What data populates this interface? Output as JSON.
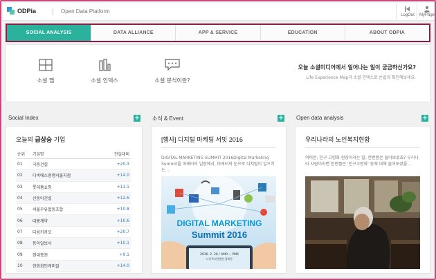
{
  "header": {
    "logo_text": "ODPia",
    "subtitle": "Open Data Platform",
    "logout_label": "LogOut",
    "mypage_label": "MyPage"
  },
  "nav": {
    "items": [
      {
        "label": "SOCIAL ANALYSIS",
        "active": true
      },
      {
        "label": "DATA ALLIANCE",
        "active": false
      },
      {
        "label": "APP & SERVICE",
        "active": false
      },
      {
        "label": "EDUCATION",
        "active": false
      },
      {
        "label": "ABOUT ODPIA",
        "active": false
      }
    ]
  },
  "features": [
    {
      "icon": "social-map-icon",
      "label": "소셜 맵"
    },
    {
      "icon": "social-index-icon",
      "label": "소셜 인덱스"
    },
    {
      "icon": "social-analysis-icon",
      "label": "소셜 분석이란?"
    }
  ],
  "promo": {
    "title": "오늘 소셜미디어에서 일어나는 일이 궁금하신가요?",
    "subtitle": "Life Experience Map과 소셜 인덱스로 손쉽게 확인해보세요."
  },
  "columns": {
    "social_index": {
      "heading": "Social Index",
      "add_label": "+"
    },
    "news_event": {
      "heading": "소식 & Event",
      "add_label": "+"
    },
    "open_data": {
      "heading": "Open data analysis",
      "add_label": "+"
    }
  },
  "social_index_card": {
    "title_prefix": "오늘의 ",
    "title_bold": "급상승",
    "title_suffix": " 기업",
    "headers": {
      "rank": "순위",
      "company": "기업명",
      "change": "전일대비"
    },
    "rows": [
      {
        "rank": "01",
        "company": "극동건설",
        "change": "+20.3"
      },
      {
        "rank": "02",
        "company": "디비에스중행서울지점",
        "change": "+14.0"
      },
      {
        "rank": "03",
        "company": "롯데홈쇼핑",
        "change": "+13.1"
      },
      {
        "rank": "04",
        "company": "신동아건설",
        "change": "+12.6"
      },
      {
        "rank": "05",
        "company": "서울우유협동조합",
        "change": "+10.8"
      },
      {
        "rank": "06",
        "company": "대홍계약",
        "change": "+10.6"
      },
      {
        "rank": "07",
        "company": "다음카카오",
        "change": "+20.7"
      },
      {
        "rank": "08",
        "company": "동아일보사",
        "change": "+10.1"
      },
      {
        "rank": "09",
        "company": "현대증권",
        "change": "+9.1"
      },
      {
        "rank": "10",
        "company": "한화회인케미칼",
        "change": "+14.0"
      }
    ]
  },
  "news_card": {
    "title": "[행사] 디지털 마케팅 서밋 2016",
    "text": "DIGITAL MARKETING SUMMIT 2016Digital Marketing Summit을 마케터의 입장에서, 마케터의 눈으로 디지털이 일으키는...",
    "image_heading_1": "DIGITAL MARKETING",
    "image_heading_2": "Summit 2016",
    "image_caption": "2016. 2. 26 / AM9 ~ PM6",
    "image_caption_2": "나인트리컨벤션 광화문"
  },
  "open_data_card": {
    "title": "우리나라의 노인복지현황",
    "text": "여러분, 인구 고령화 현상이라는 말, 한번쯤은 들어보셨죠? 우리나라 사람이라면 한번쯤은 '인구고령화' 등에 대해 들어보셨을..."
  },
  "colors": {
    "accent": "#2ab29c",
    "nav_border": "#8a1e46",
    "frame_border": "#c8487a",
    "change_text": "#2a78c2"
  }
}
